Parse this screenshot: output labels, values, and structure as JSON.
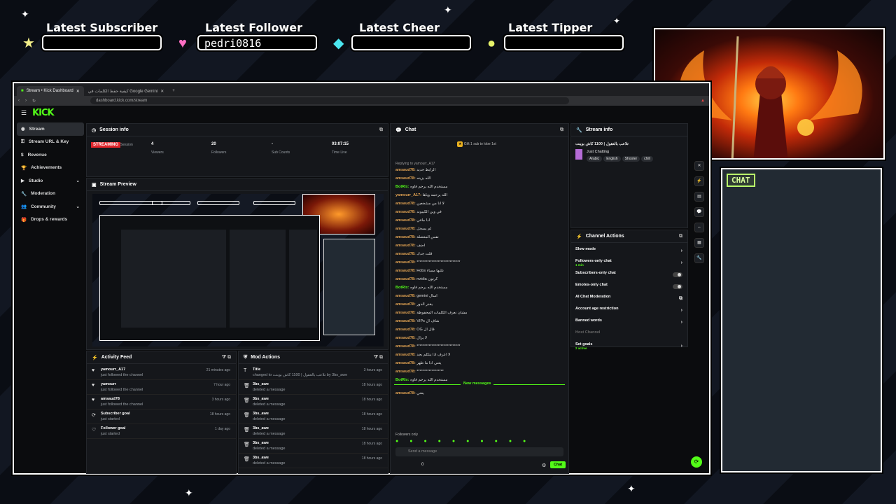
{
  "overlay": {
    "latest_subscriber_label": "Latest Subscriber",
    "latest_follower_label": "Latest Follower",
    "latest_follower_value": "pedri0816",
    "latest_cheer_label": "Latest Cheer",
    "latest_tipper_label": "Latest Tipper",
    "chat_label": "CHAT"
  },
  "browser": {
    "tab1": "Stream • Kick Dashboard",
    "tab2": "كيفية حفظ الكلمات في Google Gemini",
    "url": "dashboard.kick.com/stream"
  },
  "kick": {
    "logo": "KICK"
  },
  "sidebar": {
    "items": [
      {
        "label": "Stream",
        "icon": "broadcast-icon"
      },
      {
        "label": "Stream URL & Key",
        "icon": "key-icon"
      },
      {
        "label": "Revenue",
        "icon": "dollar-icon"
      },
      {
        "label": "Achievements",
        "icon": "trophy-icon"
      },
      {
        "label": "Studio",
        "icon": "studio-icon"
      },
      {
        "label": "Moderation",
        "icon": "wrench-icon"
      },
      {
        "label": "Community",
        "icon": "people-icon"
      },
      {
        "label": "Drops & rewards",
        "icon": "gift-icon"
      }
    ]
  },
  "session": {
    "title": "Session info",
    "badge": "STREAMING",
    "session_label": "Session",
    "viewers": "4",
    "viewers_label": "Viewers",
    "followers": "20",
    "followers_label": "Followers",
    "subs": "-",
    "subs_label": "Sub Counts",
    "time": "03:07:15",
    "time_label": "Time Live"
  },
  "preview": {
    "title": "Stream Preview"
  },
  "activity": {
    "title": "Activity Feed",
    "rows": [
      {
        "name": "yamourr_A17",
        "desc": "just followed the channel",
        "time": "21 minutes ago"
      },
      {
        "name": "yamourr",
        "desc": "just followed the channel",
        "time": "7 hour ago"
      },
      {
        "name": "amsaud78",
        "desc": "just followed the channel",
        "time": "3 hours ago"
      },
      {
        "name": "Subscriber goal",
        "desc": "just started",
        "time": "18 hours ago"
      },
      {
        "name": "Follower goal",
        "desc": "just started",
        "time": "1 day ago"
      }
    ]
  },
  "mod": {
    "title": "Mod Actions",
    "rows": [
      {
        "name": "Title",
        "desc": "changed to تلاعب بالعقول | 1100 كاش بوينت by 3bs_awe",
        "time": "3 hours ago"
      },
      {
        "name": "3bs_awe",
        "desc": "deleted a message",
        "time": "18 hours ago"
      },
      {
        "name": "3bs_awe",
        "desc": "deleted a message",
        "time": "18 hours ago"
      },
      {
        "name": "3bs_awe",
        "desc": "deleted a message",
        "time": "18 hours ago"
      },
      {
        "name": "3bs_awe",
        "desc": "deleted a message",
        "time": "18 hours ago"
      },
      {
        "name": "3bs_awe",
        "desc": "deleted a message",
        "time": "18 hours ago"
      },
      {
        "name": "3bs_awe",
        "desc": "deleted a message",
        "time": "18 hours ago"
      }
    ]
  },
  "chat": {
    "title": "Chat",
    "gift": "Gift 1 sub to lobe 1st",
    "replying": "Replying to yamourr_A17",
    "new_messages": "New messages",
    "followers_only": "Followers only",
    "send_placeholder": "Send a message",
    "chat_button": "Chat",
    "count": "0",
    "lines": [
      {
        "u": "amsaud78:",
        "m": "الرابط جديد"
      },
      {
        "u": "amsaud78:",
        "m": "الله يزينه"
      },
      {
        "u": "BotRix:",
        "m": "مستخدم الله يرحم فاوه"
      },
      {
        "u": "yamourr_A17:",
        "m": "الله يرحمه وياها"
      },
      {
        "u": "amsaud78:",
        "m": "لا انا من مشجعين"
      },
      {
        "u": "amsaud78:",
        "m": "في وين الكيبوند"
      },
      {
        "u": "amsaud78:",
        "m": "اذا مافي"
      },
      {
        "u": "amsaud78:",
        "m": "لم يسجل"
      },
      {
        "u": "amsaud78:",
        "m": "نفس المعضلة"
      },
      {
        "u": "amsaud78:",
        "m": "اضف"
      },
      {
        "u": "amsaud78:",
        "m": "قلت جدك"
      },
      {
        "u": "amsaud78:",
        "m": "*****************************"
      },
      {
        "u": "amsaud78:",
        "m": "Hobs عليها مساء"
      },
      {
        "u": "amsaud78:",
        "m": "nvidia كرتون"
      },
      {
        "u": "BotRix:",
        "m": "مستخدم الله يرحم فاوه"
      },
      {
        "u": "amsaud78:",
        "m": "gemini اسال"
      },
      {
        "u": "amsaud78:",
        "m": "يقدر الدور"
      },
      {
        "u": "amsaud78:",
        "m": "مشان نعرف الكلمات المحفوظة"
      },
      {
        "u": "amsaud78:",
        "m": "VIPs شاف ال"
      },
      {
        "u": "amsaud78:",
        "m": "OG قال ال"
      },
      {
        "u": "amsaud78:",
        "m": "لا يزال"
      },
      {
        "u": "amsaud78:",
        "m": "*****************************"
      },
      {
        "u": "amsaud78:",
        "m": "لا اعرف اذا يتكلم بجد"
      },
      {
        "u": "amsaud78:",
        "m": "يعني اذا ما ظهر"
      },
      {
        "u": "amsaud78:",
        "m": "******************"
      },
      {
        "u": "BotRix:",
        "m": "مستخدم الله يرحم فاوه"
      },
      {
        "u": "amsaud78:",
        "m": "يعني"
      }
    ]
  },
  "streaminfo": {
    "title": "Stream info",
    "stream_title": "تلاعب بالعقول | 1100 كاش بوينت",
    "category": "Just Chatting",
    "tags": [
      "Arabic",
      "English",
      "Shooter",
      "chill"
    ]
  },
  "actions": {
    "title": "Channel Actions",
    "rows": [
      {
        "label": "Slow mode",
        "kind": "arrow"
      },
      {
        "label": "Followers-only chat",
        "sub": "1 min",
        "kind": "arrow"
      },
      {
        "label": "Subscribers-only chat",
        "kind": "toggle"
      },
      {
        "label": "Emotes-only chat",
        "kind": "toggle"
      },
      {
        "label": "AI Chat Moderation",
        "kind": "link"
      },
      {
        "label": "Account age restriction",
        "kind": "arrow"
      },
      {
        "label": "Banned words",
        "kind": "arrow"
      },
      {
        "label": "Host Channel",
        "kind": "none"
      },
      {
        "label": "Set goals",
        "sub": "2 active",
        "kind": "arrow"
      }
    ]
  }
}
